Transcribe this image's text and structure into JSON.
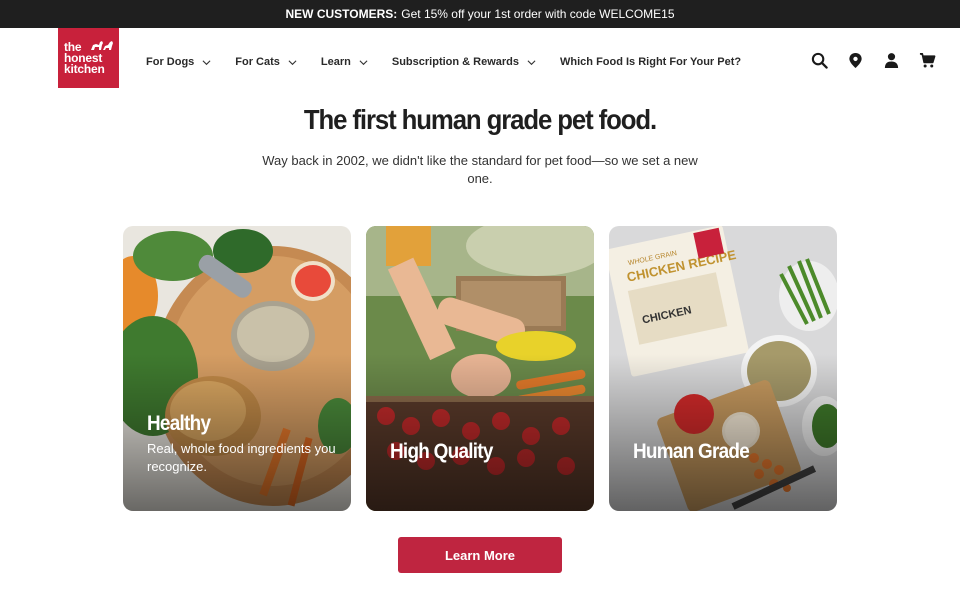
{
  "promo": {
    "label": "NEW CUSTOMERS:",
    "text": "Get 15% off your 1st order with code WELCOME15"
  },
  "header": {
    "logo": {
      "line1": "the",
      "line2": "honest",
      "line3": "kitchen"
    },
    "nav": [
      {
        "label": "For Dogs",
        "has_dropdown": true
      },
      {
        "label": "For Cats",
        "has_dropdown": true
      },
      {
        "label": "Learn",
        "has_dropdown": true
      },
      {
        "label": "Subscription & Rewards",
        "has_dropdown": true
      },
      {
        "label": "Which Food Is Right For Your Pet?",
        "has_dropdown": false
      }
    ],
    "icons": [
      "search-icon",
      "location-pin-icon",
      "account-icon",
      "cart-icon"
    ]
  },
  "hero": {
    "title": "The first human grade pet food.",
    "subtitle": "Way back in 2002, we didn't like the standard for pet food—so we set a new one."
  },
  "cards": [
    {
      "title": "Healthy",
      "description": "Real, whole food ingredients you recognize."
    },
    {
      "title": "High Quality",
      "description": ""
    },
    {
      "title": "Human Grade",
      "description": ""
    }
  ],
  "package": {
    "line1": "WHOLE GRAIN",
    "line2": "CHICKEN RECIPE",
    "line3": "CHICKEN"
  },
  "cta": {
    "label": "Learn More"
  },
  "colors": {
    "brand_red": "#c8213b",
    "button_red": "#bf2540",
    "promo_bg": "#1f1f1f"
  }
}
